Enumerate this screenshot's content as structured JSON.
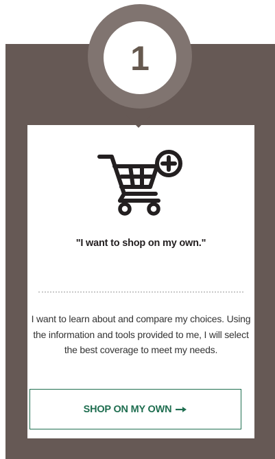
{
  "step": {
    "number": "1"
  },
  "card": {
    "icon": "cart-plus-icon",
    "quote": "\"I want to shop on my own.\"",
    "description": "I want to learn about and compare my choices. Using the information and tools provided to me, I will select the best coverage to meet my needs.",
    "button_label": "SHOP ON MY OWN",
    "button_icon": "arrow-right-icon"
  },
  "colors": {
    "panel": "#665955",
    "badge_ring": "#807470",
    "button_text": "#1f6e50",
    "button_border": "#1f6e50"
  }
}
